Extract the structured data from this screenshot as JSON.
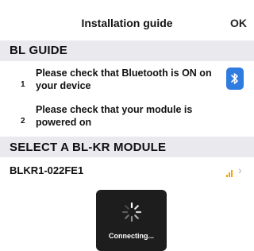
{
  "navbar": {
    "title": "Installation guide",
    "ok_label": "OK"
  },
  "bl_guide": {
    "header": "BL GUIDE",
    "steps": [
      {
        "number": "1",
        "text": "Please check that Bluetooth is ON on your device",
        "icon": "bluetooth-icon"
      },
      {
        "number": "2",
        "text": "Please check that your module is powered on"
      }
    ]
  },
  "modules": {
    "header": "SELECT A BL-KR MODULE",
    "items": [
      {
        "name": "BLKR1-022FE1",
        "signal_icon": "signal-strength-icon",
        "signal_color": "#f4a300"
      }
    ]
  },
  "hud": {
    "text": "Connecting..."
  },
  "colors": {
    "accent": "#2f7ce0",
    "section_bg": "#e9e9ee",
    "hud_bg": "#1d1d1d"
  }
}
